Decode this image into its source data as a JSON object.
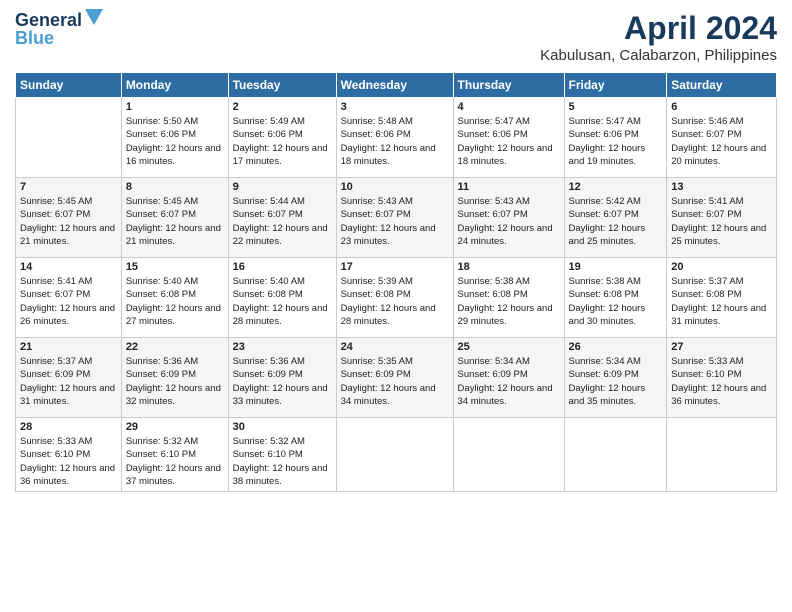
{
  "logo": {
    "line1": "General",
    "line2": "Blue"
  },
  "title": "April 2024",
  "subtitle": "Kabulusan, Calabarzon, Philippines",
  "days_of_week": [
    "Sunday",
    "Monday",
    "Tuesday",
    "Wednesday",
    "Thursday",
    "Friday",
    "Saturday"
  ],
  "weeks": [
    [
      {
        "day": "",
        "sunrise": "",
        "sunset": "",
        "daylight": ""
      },
      {
        "day": "1",
        "sunrise": "Sunrise: 5:50 AM",
        "sunset": "Sunset: 6:06 PM",
        "daylight": "Daylight: 12 hours and 16 minutes."
      },
      {
        "day": "2",
        "sunrise": "Sunrise: 5:49 AM",
        "sunset": "Sunset: 6:06 PM",
        "daylight": "Daylight: 12 hours and 17 minutes."
      },
      {
        "day": "3",
        "sunrise": "Sunrise: 5:48 AM",
        "sunset": "Sunset: 6:06 PM",
        "daylight": "Daylight: 12 hours and 18 minutes."
      },
      {
        "day": "4",
        "sunrise": "Sunrise: 5:47 AM",
        "sunset": "Sunset: 6:06 PM",
        "daylight": "Daylight: 12 hours and 18 minutes."
      },
      {
        "day": "5",
        "sunrise": "Sunrise: 5:47 AM",
        "sunset": "Sunset: 6:06 PM",
        "daylight": "Daylight: 12 hours and 19 minutes."
      },
      {
        "day": "6",
        "sunrise": "Sunrise: 5:46 AM",
        "sunset": "Sunset: 6:07 PM",
        "daylight": "Daylight: 12 hours and 20 minutes."
      }
    ],
    [
      {
        "day": "7",
        "sunrise": "Sunrise: 5:45 AM",
        "sunset": "Sunset: 6:07 PM",
        "daylight": "Daylight: 12 hours and 21 minutes."
      },
      {
        "day": "8",
        "sunrise": "Sunrise: 5:45 AM",
        "sunset": "Sunset: 6:07 PM",
        "daylight": "Daylight: 12 hours and 21 minutes."
      },
      {
        "day": "9",
        "sunrise": "Sunrise: 5:44 AM",
        "sunset": "Sunset: 6:07 PM",
        "daylight": "Daylight: 12 hours and 22 minutes."
      },
      {
        "day": "10",
        "sunrise": "Sunrise: 5:43 AM",
        "sunset": "Sunset: 6:07 PM",
        "daylight": "Daylight: 12 hours and 23 minutes."
      },
      {
        "day": "11",
        "sunrise": "Sunrise: 5:43 AM",
        "sunset": "Sunset: 6:07 PM",
        "daylight": "Daylight: 12 hours and 24 minutes."
      },
      {
        "day": "12",
        "sunrise": "Sunrise: 5:42 AM",
        "sunset": "Sunset: 6:07 PM",
        "daylight": "Daylight: 12 hours and 25 minutes."
      },
      {
        "day": "13",
        "sunrise": "Sunrise: 5:41 AM",
        "sunset": "Sunset: 6:07 PM",
        "daylight": "Daylight: 12 hours and 25 minutes."
      }
    ],
    [
      {
        "day": "14",
        "sunrise": "Sunrise: 5:41 AM",
        "sunset": "Sunset: 6:07 PM",
        "daylight": "Daylight: 12 hours and 26 minutes."
      },
      {
        "day": "15",
        "sunrise": "Sunrise: 5:40 AM",
        "sunset": "Sunset: 6:08 PM",
        "daylight": "Daylight: 12 hours and 27 minutes."
      },
      {
        "day": "16",
        "sunrise": "Sunrise: 5:40 AM",
        "sunset": "Sunset: 6:08 PM",
        "daylight": "Daylight: 12 hours and 28 minutes."
      },
      {
        "day": "17",
        "sunrise": "Sunrise: 5:39 AM",
        "sunset": "Sunset: 6:08 PM",
        "daylight": "Daylight: 12 hours and 28 minutes."
      },
      {
        "day": "18",
        "sunrise": "Sunrise: 5:38 AM",
        "sunset": "Sunset: 6:08 PM",
        "daylight": "Daylight: 12 hours and 29 minutes."
      },
      {
        "day": "19",
        "sunrise": "Sunrise: 5:38 AM",
        "sunset": "Sunset: 6:08 PM",
        "daylight": "Daylight: 12 hours and 30 minutes."
      },
      {
        "day": "20",
        "sunrise": "Sunrise: 5:37 AM",
        "sunset": "Sunset: 6:08 PM",
        "daylight": "Daylight: 12 hours and 31 minutes."
      }
    ],
    [
      {
        "day": "21",
        "sunrise": "Sunrise: 5:37 AM",
        "sunset": "Sunset: 6:09 PM",
        "daylight": "Daylight: 12 hours and 31 minutes."
      },
      {
        "day": "22",
        "sunrise": "Sunrise: 5:36 AM",
        "sunset": "Sunset: 6:09 PM",
        "daylight": "Daylight: 12 hours and 32 minutes."
      },
      {
        "day": "23",
        "sunrise": "Sunrise: 5:36 AM",
        "sunset": "Sunset: 6:09 PM",
        "daylight": "Daylight: 12 hours and 33 minutes."
      },
      {
        "day": "24",
        "sunrise": "Sunrise: 5:35 AM",
        "sunset": "Sunset: 6:09 PM",
        "daylight": "Daylight: 12 hours and 34 minutes."
      },
      {
        "day": "25",
        "sunrise": "Sunrise: 5:34 AM",
        "sunset": "Sunset: 6:09 PM",
        "daylight": "Daylight: 12 hours and 34 minutes."
      },
      {
        "day": "26",
        "sunrise": "Sunrise: 5:34 AM",
        "sunset": "Sunset: 6:09 PM",
        "daylight": "Daylight: 12 hours and 35 minutes."
      },
      {
        "day": "27",
        "sunrise": "Sunrise: 5:33 AM",
        "sunset": "Sunset: 6:10 PM",
        "daylight": "Daylight: 12 hours and 36 minutes."
      }
    ],
    [
      {
        "day": "28",
        "sunrise": "Sunrise: 5:33 AM",
        "sunset": "Sunset: 6:10 PM",
        "daylight": "Daylight: 12 hours and 36 minutes."
      },
      {
        "day": "29",
        "sunrise": "Sunrise: 5:32 AM",
        "sunset": "Sunset: 6:10 PM",
        "daylight": "Daylight: 12 hours and 37 minutes."
      },
      {
        "day": "30",
        "sunrise": "Sunrise: 5:32 AM",
        "sunset": "Sunset: 6:10 PM",
        "daylight": "Daylight: 12 hours and 38 minutes."
      },
      {
        "day": "",
        "sunrise": "",
        "sunset": "",
        "daylight": ""
      },
      {
        "day": "",
        "sunrise": "",
        "sunset": "",
        "daylight": ""
      },
      {
        "day": "",
        "sunrise": "",
        "sunset": "",
        "daylight": ""
      },
      {
        "day": "",
        "sunrise": "",
        "sunset": "",
        "daylight": ""
      }
    ]
  ]
}
